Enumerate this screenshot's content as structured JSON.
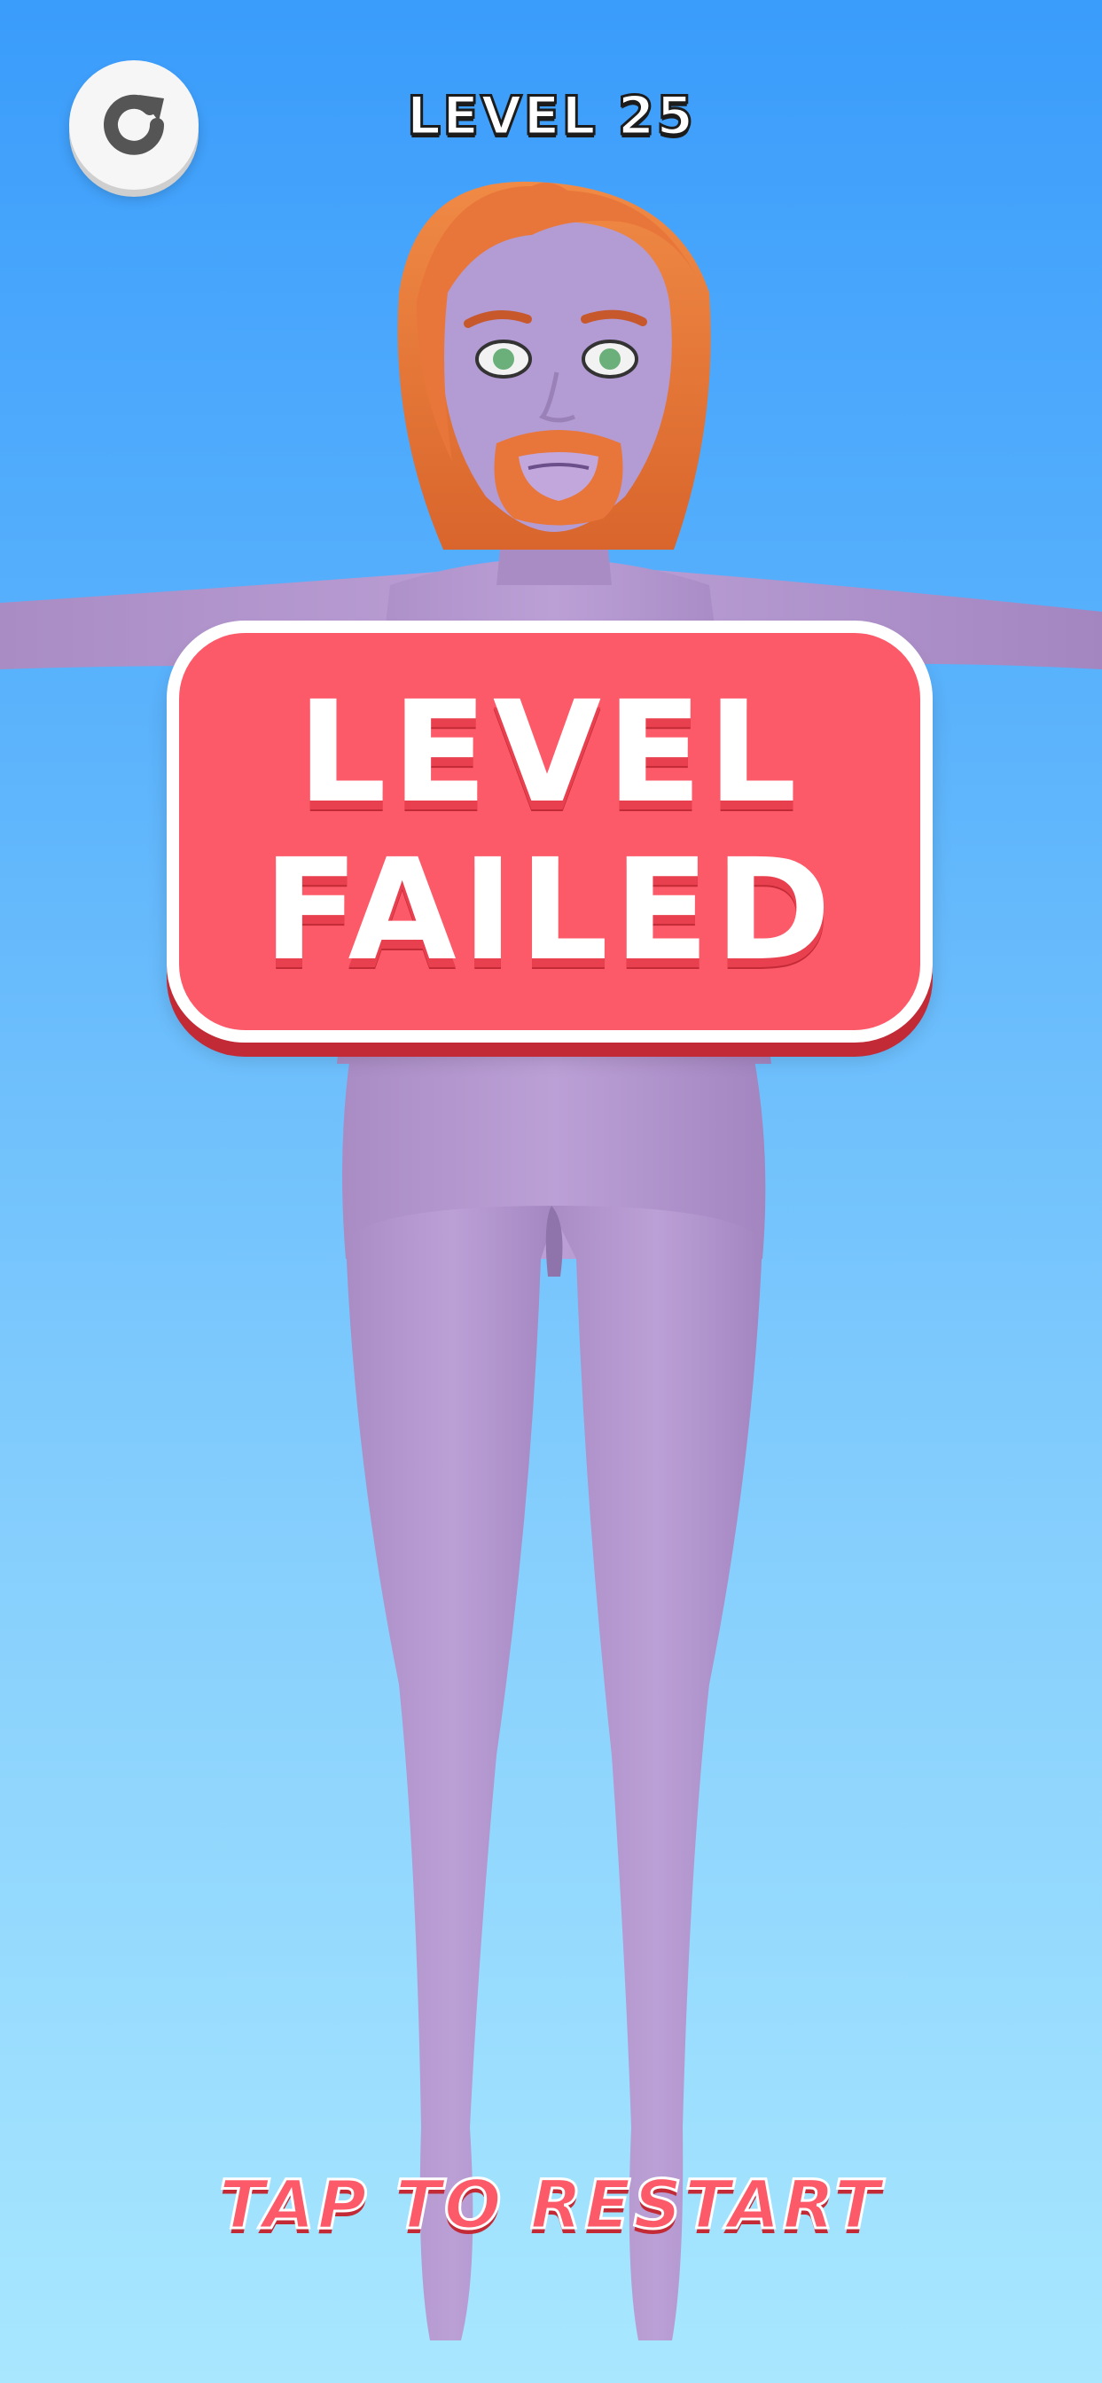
{
  "header": {
    "level_label": "LEVEL 25",
    "restart_icon": "restart-icon"
  },
  "banner": {
    "line1": "LEVEL",
    "line2": "FAILED"
  },
  "footer": {
    "tap_label": "TAP TO RESTART"
  },
  "colors": {
    "sky_top": "#3a9cfb",
    "sky_bottom": "#a8e7fe",
    "banner_fill": "#fd5a69",
    "banner_shadow": "#c22a35",
    "skin": "#b79bd1",
    "hair": "#e8763a"
  }
}
